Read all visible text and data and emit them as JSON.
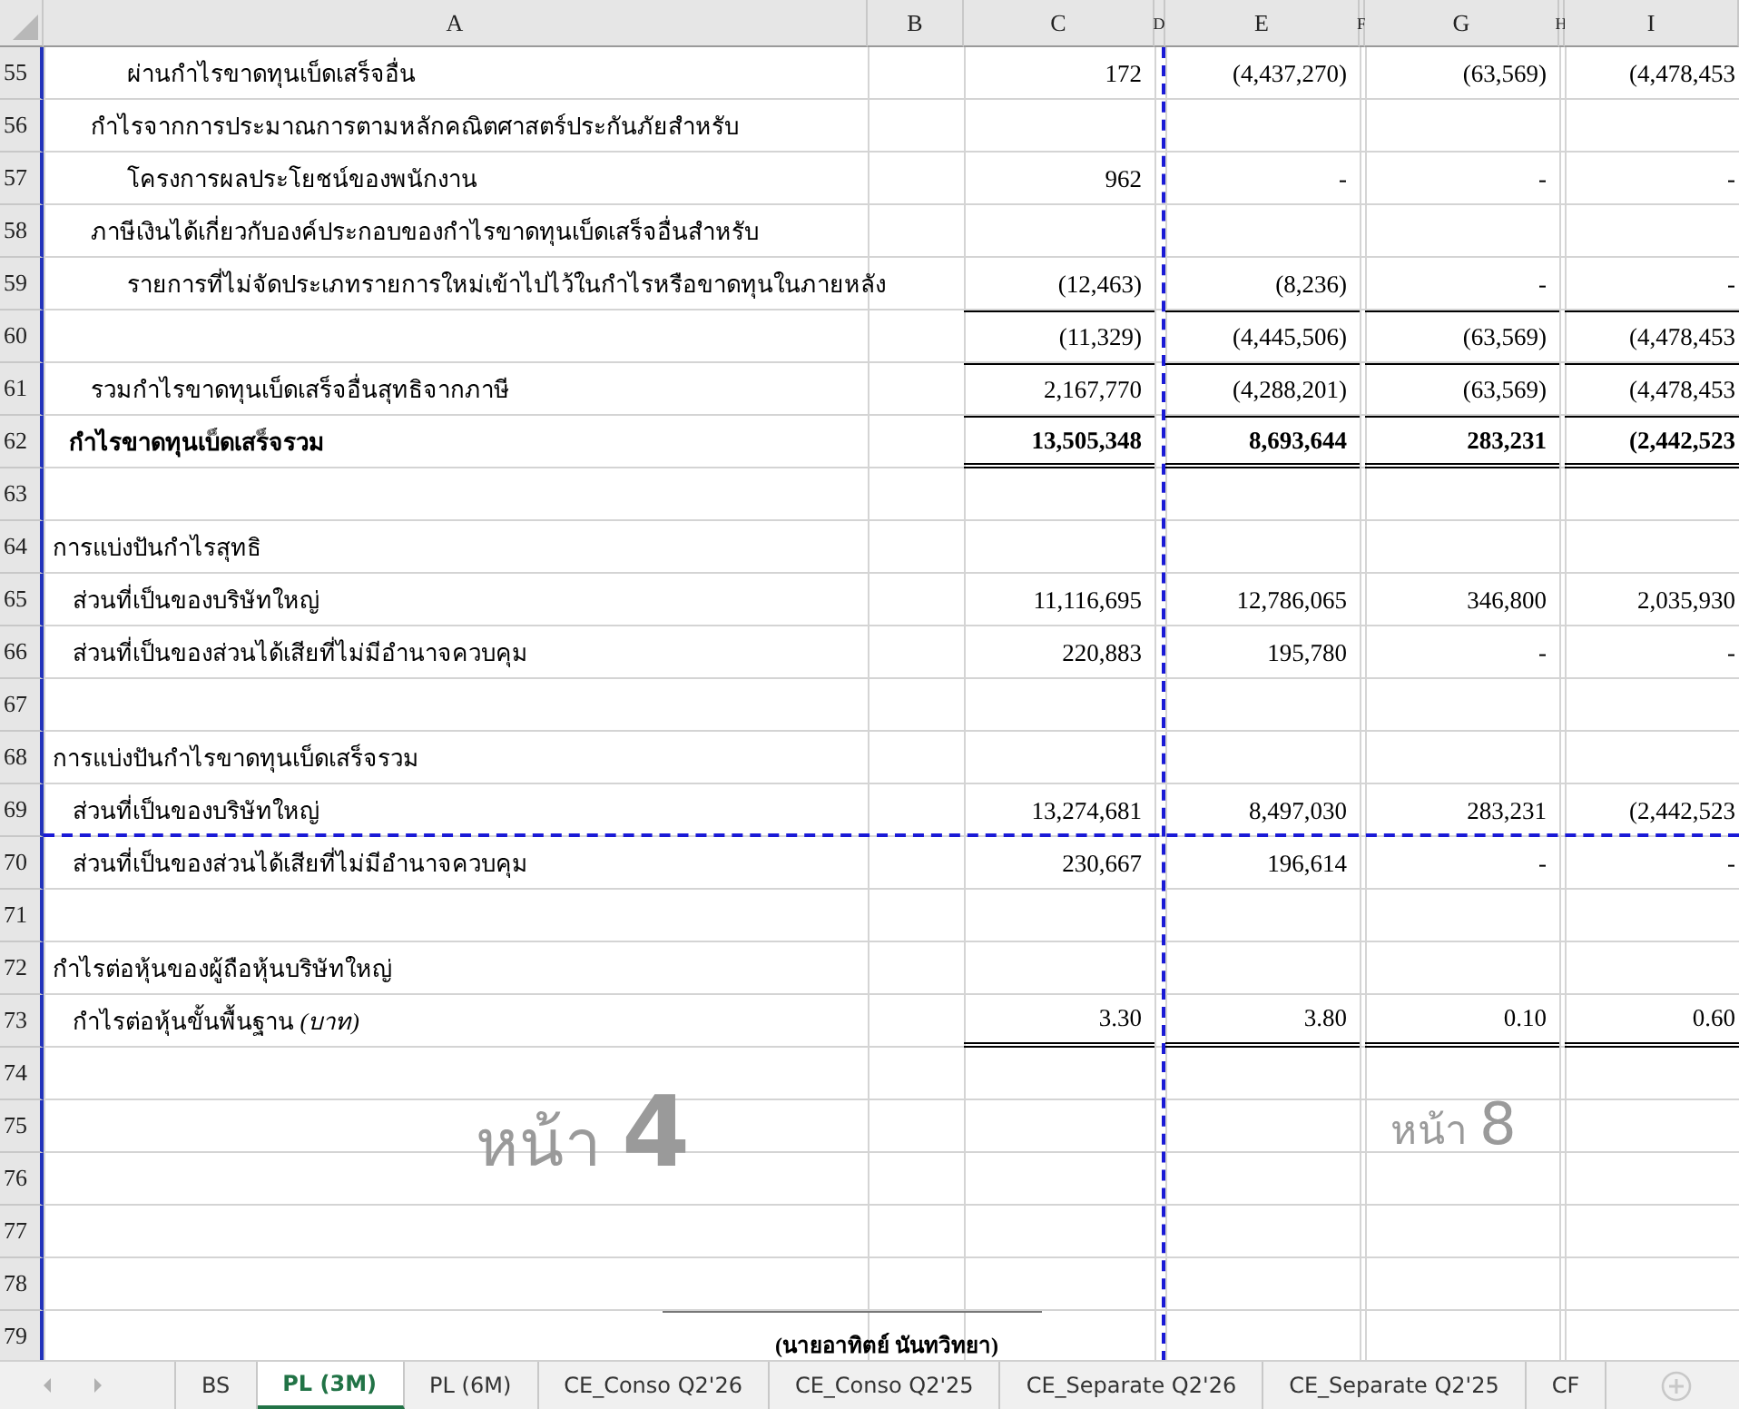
{
  "columns": [
    "A",
    "B",
    "C",
    "D",
    "E",
    "F",
    "G",
    "H",
    "I"
  ],
  "rows": [
    {
      "num": "55",
      "kind": "detail",
      "rule_above": false,
      "double_underline": false,
      "label": "ผ่านกำไรขาดทุนเบ็ดเสร็จอื่น",
      "c": "172",
      "e": "(4,437,270)",
      "g": "(63,569)",
      "i": "(4,478,453"
    },
    {
      "num": "56",
      "kind": "subitem",
      "rule_above": false,
      "double_underline": false,
      "label": "กำไรจากการประมาณการตามหลักคณิตศาสตร์ประกันภัยสำหรับ"
    },
    {
      "num": "57",
      "kind": "detail",
      "rule_above": false,
      "double_underline": false,
      "label": "โครงการผลประโยชน์ของพนักงาน",
      "c": "962",
      "e": "-",
      "g": "-",
      "i": "-"
    },
    {
      "num": "58",
      "kind": "subitem",
      "rule_above": false,
      "double_underline": false,
      "label": "ภาษีเงินได้เกี่ยวกับองค์ประกอบของกำไรขาดทุนเบ็ดเสร็จอื่นสำหรับ"
    },
    {
      "num": "59",
      "kind": "detail",
      "rule_above": false,
      "double_underline": false,
      "label": "รายการที่ไม่จัดประเภทรายการใหม่เข้าไปไว้ในกำไรหรือขาดทุนในภายหลัง",
      "c": "(12,463)",
      "e": "(8,236)",
      "g": "-",
      "i": "-"
    },
    {
      "num": "60",
      "kind": "blank",
      "rule_above": true,
      "double_underline": false,
      "c": "(11,329)",
      "e": "(4,445,506)",
      "g": "(63,569)",
      "i": "(4,478,453"
    },
    {
      "num": "61",
      "kind": "subitem",
      "rule_above": true,
      "double_underline": false,
      "label": "รวมกำไรขาดทุนเบ็ดเสร็จอื่นสุทธิจากภาษี",
      "c": "2,167,770",
      "e": "(4,288,201)",
      "g": "(63,569)",
      "i": "(4,478,453"
    },
    {
      "num": "62",
      "kind": "total",
      "rule_above": true,
      "double_underline": true,
      "label": "กำไรขาดทุนเบ็ดเสร็จรวม",
      "c": "13,505,348",
      "e": "8,693,644",
      "g": "283,231",
      "i": "(2,442,523"
    },
    {
      "num": "63",
      "kind": "blank",
      "rule_above": false,
      "double_underline": false
    },
    {
      "num": "64",
      "kind": "section",
      "rule_above": false,
      "double_underline": false,
      "label": "การแบ่งปันกำไรสุทธิ"
    },
    {
      "num": "65",
      "kind": "item",
      "rule_above": false,
      "double_underline": false,
      "label": "ส่วนที่เป็นของบริษัทใหญ่",
      "c": "11,116,695",
      "e": "12,786,065",
      "g": "346,800",
      "i": "2,035,930"
    },
    {
      "num": "66",
      "kind": "item",
      "rule_above": false,
      "double_underline": false,
      "label": "ส่วนที่เป็นของส่วนได้เสียที่ไม่มีอำนาจควบคุม",
      "c": "220,883",
      "e": "195,780",
      "g": "-",
      "i": "-"
    },
    {
      "num": "67",
      "kind": "blank",
      "rule_above": false,
      "double_underline": false
    },
    {
      "num": "68",
      "kind": "section",
      "rule_above": false,
      "double_underline": false,
      "label": "การแบ่งปันกำไรขาดทุนเบ็ดเสร็จรวม"
    },
    {
      "num": "69",
      "kind": "item",
      "rule_above": false,
      "double_underline": false,
      "label": "ส่วนที่เป็นของบริษัทใหญ่",
      "c": "13,274,681",
      "e": "8,497,030",
      "g": "283,231",
      "i": "(2,442,523"
    },
    {
      "num": "70",
      "kind": "item",
      "rule_above": false,
      "double_underline": false,
      "label": "ส่วนที่เป็นของส่วนได้เสียที่ไม่มีอำนาจควบคุม",
      "c": "230,667",
      "e": "196,614",
      "g": "-",
      "i": "-"
    },
    {
      "num": "71",
      "kind": "blank",
      "rule_above": false,
      "double_underline": false
    },
    {
      "num": "72",
      "kind": "section",
      "rule_above": false,
      "double_underline": false,
      "label": "กำไรต่อหุ้นของผู้ถือหุ้นบริษัทใหญ่"
    },
    {
      "num": "73",
      "kind": "item",
      "rule_above": false,
      "double_underline": true,
      "label": "กำไรต่อหุ้นขั้นพื้นฐาน *(บาท)*",
      "c": "3.30",
      "e": "3.80",
      "g": "0.10",
      "i": "0.60"
    },
    {
      "num": "74",
      "kind": "blank",
      "rule_above": false,
      "double_underline": false
    },
    {
      "num": "75",
      "kind": "blank",
      "rule_above": false,
      "double_underline": false
    },
    {
      "num": "76",
      "kind": "blank",
      "rule_above": false,
      "double_underline": false
    },
    {
      "num": "77",
      "kind": "blank",
      "rule_above": false,
      "double_underline": false
    },
    {
      "num": "78",
      "kind": "blank",
      "rule_above": false,
      "double_underline": false
    },
    {
      "num": "79",
      "kind": "signature",
      "rule_above": false,
      "double_underline": false,
      "label": "(นายอาทิตย์ นันทวิทยา)"
    }
  ],
  "page_labels": [
    {
      "kind": "large",
      "text": "หน้า",
      "number": "4"
    },
    {
      "kind": "small",
      "text": "หน้า",
      "number": "8"
    }
  ],
  "sheet_tabs": [
    {
      "label": "BS",
      "selected": false
    },
    {
      "label": "PL (3M)",
      "selected": true
    },
    {
      "label": "PL (6M)",
      "selected": false
    },
    {
      "label": "CE_Conso Q2'26",
      "selected": false
    },
    {
      "label": "CE_Conso Q2'25",
      "selected": false
    },
    {
      "label": "CE_Separate Q2'26",
      "selected": false
    },
    {
      "label": "CE_Separate Q2'25",
      "selected": false
    },
    {
      "label": "CF",
      "selected": false
    }
  ]
}
